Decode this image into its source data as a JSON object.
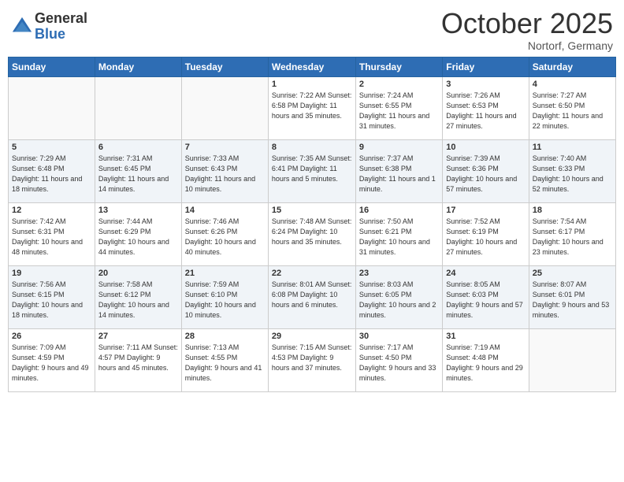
{
  "logo": {
    "general": "General",
    "blue": "Blue"
  },
  "title": "October 2025",
  "location": "Nortorf, Germany",
  "days_of_week": [
    "Sunday",
    "Monday",
    "Tuesday",
    "Wednesday",
    "Thursday",
    "Friday",
    "Saturday"
  ],
  "weeks": [
    [
      {
        "day": "",
        "info": ""
      },
      {
        "day": "",
        "info": ""
      },
      {
        "day": "",
        "info": ""
      },
      {
        "day": "1",
        "info": "Sunrise: 7:22 AM\nSunset: 6:58 PM\nDaylight: 11 hours\nand 35 minutes."
      },
      {
        "day": "2",
        "info": "Sunrise: 7:24 AM\nSunset: 6:55 PM\nDaylight: 11 hours\nand 31 minutes."
      },
      {
        "day": "3",
        "info": "Sunrise: 7:26 AM\nSunset: 6:53 PM\nDaylight: 11 hours\nand 27 minutes."
      },
      {
        "day": "4",
        "info": "Sunrise: 7:27 AM\nSunset: 6:50 PM\nDaylight: 11 hours\nand 22 minutes."
      }
    ],
    [
      {
        "day": "5",
        "info": "Sunrise: 7:29 AM\nSunset: 6:48 PM\nDaylight: 11 hours\nand 18 minutes."
      },
      {
        "day": "6",
        "info": "Sunrise: 7:31 AM\nSunset: 6:45 PM\nDaylight: 11 hours\nand 14 minutes."
      },
      {
        "day": "7",
        "info": "Sunrise: 7:33 AM\nSunset: 6:43 PM\nDaylight: 11 hours\nand 10 minutes."
      },
      {
        "day": "8",
        "info": "Sunrise: 7:35 AM\nSunset: 6:41 PM\nDaylight: 11 hours\nand 5 minutes."
      },
      {
        "day": "9",
        "info": "Sunrise: 7:37 AM\nSunset: 6:38 PM\nDaylight: 11 hours\nand 1 minute."
      },
      {
        "day": "10",
        "info": "Sunrise: 7:39 AM\nSunset: 6:36 PM\nDaylight: 10 hours\nand 57 minutes."
      },
      {
        "day": "11",
        "info": "Sunrise: 7:40 AM\nSunset: 6:33 PM\nDaylight: 10 hours\nand 52 minutes."
      }
    ],
    [
      {
        "day": "12",
        "info": "Sunrise: 7:42 AM\nSunset: 6:31 PM\nDaylight: 10 hours\nand 48 minutes."
      },
      {
        "day": "13",
        "info": "Sunrise: 7:44 AM\nSunset: 6:29 PM\nDaylight: 10 hours\nand 44 minutes."
      },
      {
        "day": "14",
        "info": "Sunrise: 7:46 AM\nSunset: 6:26 PM\nDaylight: 10 hours\nand 40 minutes."
      },
      {
        "day": "15",
        "info": "Sunrise: 7:48 AM\nSunset: 6:24 PM\nDaylight: 10 hours\nand 35 minutes."
      },
      {
        "day": "16",
        "info": "Sunrise: 7:50 AM\nSunset: 6:21 PM\nDaylight: 10 hours\nand 31 minutes."
      },
      {
        "day": "17",
        "info": "Sunrise: 7:52 AM\nSunset: 6:19 PM\nDaylight: 10 hours\nand 27 minutes."
      },
      {
        "day": "18",
        "info": "Sunrise: 7:54 AM\nSunset: 6:17 PM\nDaylight: 10 hours\nand 23 minutes."
      }
    ],
    [
      {
        "day": "19",
        "info": "Sunrise: 7:56 AM\nSunset: 6:15 PM\nDaylight: 10 hours\nand 18 minutes."
      },
      {
        "day": "20",
        "info": "Sunrise: 7:58 AM\nSunset: 6:12 PM\nDaylight: 10 hours\nand 14 minutes."
      },
      {
        "day": "21",
        "info": "Sunrise: 7:59 AM\nSunset: 6:10 PM\nDaylight: 10 hours\nand 10 minutes."
      },
      {
        "day": "22",
        "info": "Sunrise: 8:01 AM\nSunset: 6:08 PM\nDaylight: 10 hours\nand 6 minutes."
      },
      {
        "day": "23",
        "info": "Sunrise: 8:03 AM\nSunset: 6:05 PM\nDaylight: 10 hours\nand 2 minutes."
      },
      {
        "day": "24",
        "info": "Sunrise: 8:05 AM\nSunset: 6:03 PM\nDaylight: 9 hours\nand 57 minutes."
      },
      {
        "day": "25",
        "info": "Sunrise: 8:07 AM\nSunset: 6:01 PM\nDaylight: 9 hours\nand 53 minutes."
      }
    ],
    [
      {
        "day": "26",
        "info": "Sunrise: 7:09 AM\nSunset: 4:59 PM\nDaylight: 9 hours\nand 49 minutes."
      },
      {
        "day": "27",
        "info": "Sunrise: 7:11 AM\nSunset: 4:57 PM\nDaylight: 9 hours\nand 45 minutes."
      },
      {
        "day": "28",
        "info": "Sunrise: 7:13 AM\nSunset: 4:55 PM\nDaylight: 9 hours\nand 41 minutes."
      },
      {
        "day": "29",
        "info": "Sunrise: 7:15 AM\nSunset: 4:53 PM\nDaylight: 9 hours\nand 37 minutes."
      },
      {
        "day": "30",
        "info": "Sunrise: 7:17 AM\nSunset: 4:50 PM\nDaylight: 9 hours\nand 33 minutes."
      },
      {
        "day": "31",
        "info": "Sunrise: 7:19 AM\nSunset: 4:48 PM\nDaylight: 9 hours\nand 29 minutes."
      },
      {
        "day": "",
        "info": ""
      }
    ]
  ]
}
